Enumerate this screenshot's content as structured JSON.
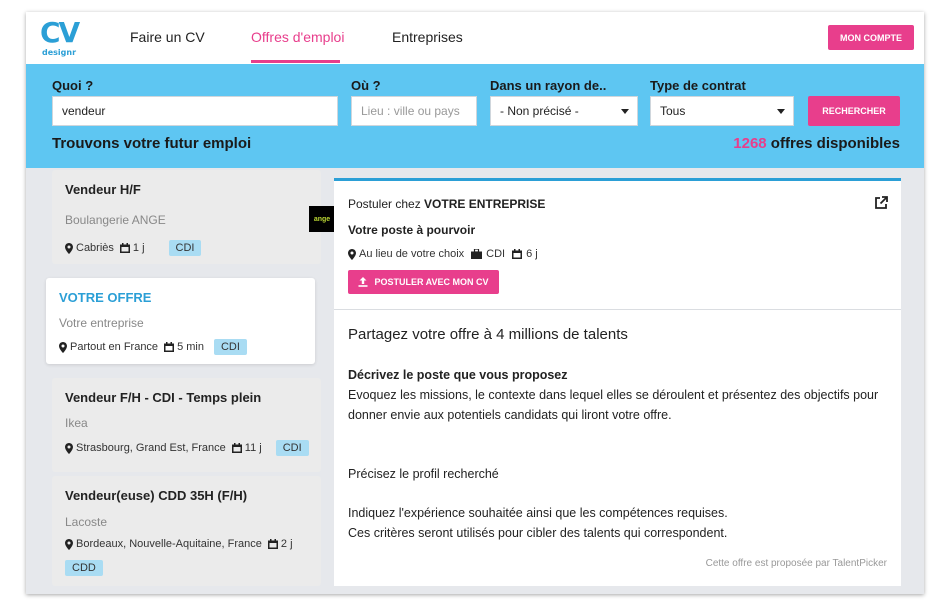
{
  "header": {
    "logo_text": "CV",
    "logo_sub": "designr",
    "nav": [
      "Faire un CV",
      "Offres d'emploi",
      "Entreprises"
    ],
    "account_button": "MON COMPTE"
  },
  "search": {
    "what_label": "Quoi ?",
    "what_value": "vendeur",
    "where_label": "Où ?",
    "where_placeholder": "Lieu : ville ou pays",
    "radius_label": "Dans un rayon de..",
    "radius_value": "- Non précisé -",
    "contract_label": "Type de contrat",
    "contract_value": "Tous",
    "button": "RECHERCHER",
    "headline": "Trouvons votre futur emploi",
    "count": "1268",
    "count_suffix": " offres disponibles"
  },
  "listings": [
    {
      "title": "Vendeur H/F",
      "company": "Boulangerie ANGE",
      "location": "Cabriès",
      "age": "1 j",
      "contract": "CDI",
      "logo_text": "ange"
    },
    {
      "title": "VOTRE OFFRE",
      "company": "Votre entreprise",
      "location": "Partout en France",
      "age": "5 min",
      "contract": "CDI"
    },
    {
      "title": "Vendeur F/H - CDI - Temps plein",
      "company": "Ikea",
      "location": "Strasbourg, Grand Est, France",
      "age": "11 j",
      "contract": "CDI"
    },
    {
      "title": "Vendeur(euse) CDD 35H (F/H)",
      "company": "Lacoste",
      "location": "Bordeaux, Nouvelle-Aquitaine, France",
      "age": "2 j",
      "contract": "CDD"
    }
  ],
  "detail": {
    "apply_prefix": "Postuler chez ",
    "apply_company": "VOTRE ENTREPRISE",
    "post_title": "Votre poste à pourvoir",
    "location": "Au lieu de votre choix",
    "contract": "CDI",
    "age": "6 j",
    "apply_button": "POSTULER AVEC MON CV",
    "share_title": "Partagez votre offre à 4 millions de talents",
    "describe_heading": "Décrivez le poste que vous proposez",
    "describe_text": "Evoquez les missions, le contexte dans lequel elles se déroulent et présentez des objectifs pour donner envie aux potentiels candidats qui liront votre offre.",
    "profile_heading": "Précisez le profil recherché",
    "profile_text_1": "Indiquez l'expérience souhaitée ainsi que les compétences requises.",
    "profile_text_2": "Ces critères seront utilisés pour cibler des talents qui correspondent.",
    "footer": "Cette offre est proposée par TalentPicker"
  },
  "colors": {
    "accent_pink": "#e83e8c",
    "accent_blue": "#2b9fd6",
    "band": "#5ec6f2",
    "tag": "#a9dcf3"
  }
}
